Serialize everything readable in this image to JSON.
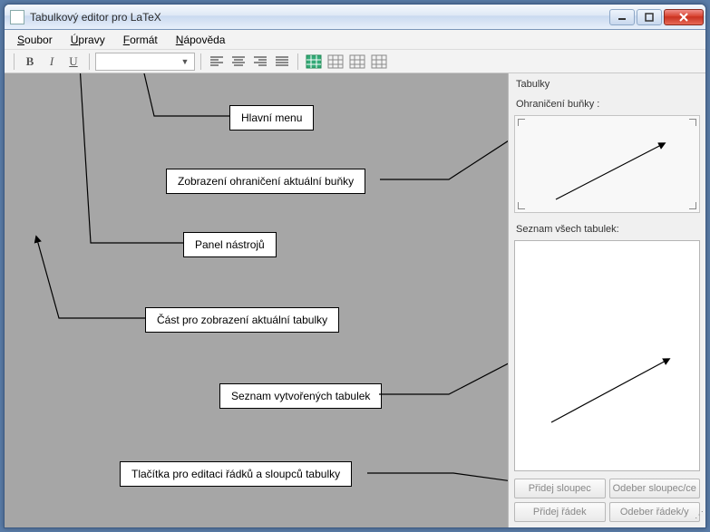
{
  "window": {
    "title": "Tabulkový editor pro LaTeX"
  },
  "menubar": {
    "items": [
      {
        "label": "Soubor",
        "u": "S"
      },
      {
        "label": "Úpravy",
        "u": "Ú"
      },
      {
        "label": "Formát",
        "u": "F"
      },
      {
        "label": "Nápověda",
        "u": "N"
      }
    ]
  },
  "toolbar": {
    "bold": "B",
    "italic": "I",
    "underline": "U"
  },
  "side": {
    "title": "Tabulky",
    "border_label": "Ohraničení buňky :",
    "list_label": "Seznam všech tabulek:",
    "buttons": {
      "add_col": "Přidej sloupec",
      "del_col": "Odeber sloupec/ce",
      "add_row": "Přidej řádek",
      "del_row": "Odeber řádek/y"
    }
  },
  "annotations": {
    "main_menu": "Hlavní menu",
    "cell_border_view": "Zobrazení ohraničení aktuální buňky",
    "toolbar_panel": "Panel nástrojů",
    "table_area": "Část pro zobrazení aktuální tabulky",
    "tables_list": "Seznam vytvořených tabulek",
    "row_col_buttons": "Tlačítka pro editaci řádků a sloupců tabulky"
  }
}
